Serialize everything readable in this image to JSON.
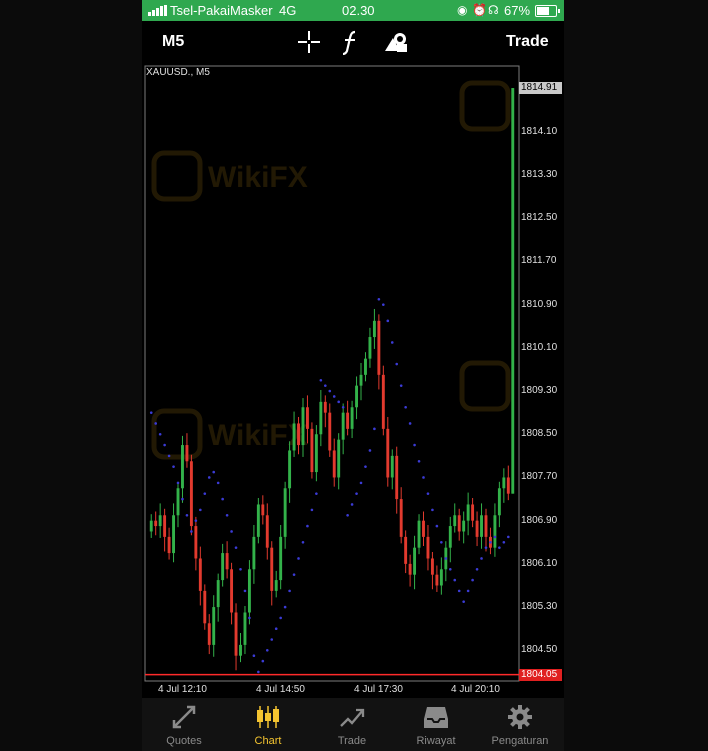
{
  "status_bar": {
    "carrier": "Tsel-PakaiMasker",
    "network": "4G",
    "time": "02.30",
    "battery": "67%"
  },
  "toolbar": {
    "timeframe": "M5",
    "trade_label": "Trade",
    "icons": [
      "crosshair-icon",
      "function-icon",
      "objects-icon"
    ]
  },
  "chart": {
    "symbol_label": "XAUUSD., M5",
    "current_price_tag": "1814.91",
    "line_price_tag": "1804.05",
    "y_labels": [
      "1814.10",
      "1813.30",
      "1812.50",
      "1811.70",
      "1810.90",
      "1810.10",
      "1809.30",
      "1808.50",
      "1807.70",
      "1806.90",
      "1806.10",
      "1805.30",
      "1804.50"
    ],
    "x_labels": [
      "4 Jul 12:10",
      "4 Jul 14:50",
      "4 Jul 17:30",
      "4 Jul 20:10"
    ],
    "colors": {
      "bull": "#33b24a",
      "bear": "#e23a2e",
      "sar": "#3b3bd6",
      "line": "#ff2a2a",
      "watermark": "#7a5a10"
    }
  },
  "chart_data": {
    "type": "candlestick",
    "title": "XAUUSD., M5",
    "ylim": [
      1803.95,
      1815.3
    ],
    "price_line": 1804.05,
    "last_price": 1814.91,
    "x_ticks": [
      "4 Jul 12:10",
      "4 Jul 14:50",
      "4 Jul 17:30",
      "4 Jul 20:10"
    ],
    "closes": [
      1806.9,
      1806.8,
      1807.0,
      1806.6,
      1806.3,
      1807.0,
      1807.5,
      1808.3,
      1808.0,
      1806.8,
      1806.2,
      1805.6,
      1805.0,
      1804.6,
      1805.3,
      1805.8,
      1806.3,
      1806.0,
      1805.2,
      1804.4,
      1804.6,
      1805.2,
      1806.0,
      1806.6,
      1807.2,
      1807.0,
      1806.4,
      1805.6,
      1805.8,
      1806.6,
      1807.5,
      1808.2,
      1808.7,
      1808.3,
      1809.0,
      1808.6,
      1807.8,
      1808.5,
      1809.1,
      1808.9,
      1808.2,
      1807.7,
      1808.4,
      1808.9,
      1808.6,
      1809.0,
      1809.4,
      1809.6,
      1809.9,
      1810.3,
      1810.6,
      1809.6,
      1808.6,
      1807.7,
      1808.1,
      1807.3,
      1806.6,
      1806.1,
      1805.9,
      1806.4,
      1806.9,
      1806.6,
      1806.2,
      1805.9,
      1805.7,
      1806.0,
      1806.4,
      1806.8,
      1807.0,
      1806.7,
      1806.9,
      1807.2,
      1806.9,
      1806.6,
      1807.0,
      1806.6,
      1806.4,
      1807.0,
      1807.5,
      1807.7,
      1807.4,
      1814.91
    ],
    "sar": [
      1808.9,
      1808.7,
      1808.5,
      1808.3,
      1808.1,
      1807.9,
      1807.6,
      1807.3,
      1807.0,
      1806.7,
      1806.9,
      1807.1,
      1807.4,
      1807.7,
      1807.8,
      1807.6,
      1807.3,
      1807.0,
      1806.7,
      1806.4,
      1806.0,
      1805.6,
      1805.1,
      1804.4,
      1804.1,
      1804.3,
      1804.5,
      1804.7,
      1804.9,
      1805.1,
      1805.3,
      1805.6,
      1805.9,
      1806.2,
      1806.5,
      1806.8,
      1807.1,
      1807.4,
      1809.5,
      1809.4,
      1809.3,
      1809.2,
      1809.1,
      1809.0,
      1807.0,
      1807.2,
      1807.4,
      1807.6,
      1807.9,
      1808.2,
      1808.6,
      1811.0,
      1810.9,
      1810.6,
      1810.2,
      1809.8,
      1809.4,
      1809.0,
      1808.7,
      1808.3,
      1808.0,
      1807.7,
      1807.4,
      1807.1,
      1806.8,
      1806.5,
      1806.2,
      1806.0,
      1805.8,
      1805.6,
      1805.4,
      1805.6,
      1805.8,
      1806.0,
      1806.2,
      1806.4,
      1806.5,
      1806.6,
      1806.4,
      1806.5,
      1806.6
    ]
  },
  "tabs": [
    {
      "label": "Quotes",
      "icon": "quotes-icon",
      "active": false
    },
    {
      "label": "Chart",
      "icon": "candlestick-icon",
      "active": true
    },
    {
      "label": "Trade",
      "icon": "trade-icon",
      "active": false
    },
    {
      "label": "Riwayat",
      "icon": "inbox-icon",
      "active": false
    },
    {
      "label": "Pengaturan",
      "icon": "gear-icon",
      "active": false
    }
  ]
}
